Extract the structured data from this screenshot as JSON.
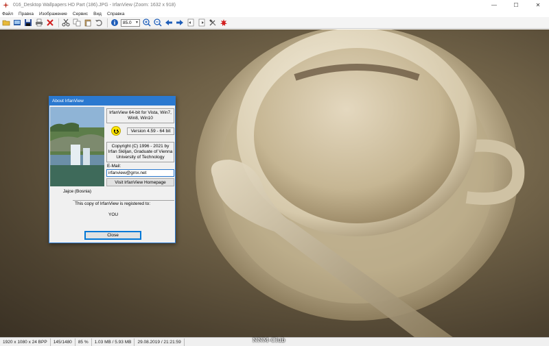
{
  "window": {
    "title": "016_Desktop Wallpapers  HD Part (186).JPG - IrfanView (Zoom: 1632 x 918)",
    "controls": [
      "—",
      "☐",
      "✕"
    ]
  },
  "menu": [
    "Файл",
    "Правка",
    "Изображение",
    "Сервис",
    "Вид",
    "Справка"
  ],
  "toolbar": {
    "zoom_value": "85.0",
    "icons": [
      "open-icon",
      "slideshow-icon",
      "save-icon",
      "print-icon",
      "delete-icon",
      "cut-icon",
      "copy-icon",
      "paste-icon",
      "undo-icon",
      "info-icon",
      "zoom-in-icon",
      "zoom-out-icon",
      "prev-icon",
      "next-icon",
      "prev-page-icon",
      "next-page-icon",
      "settings-icon",
      "exit-icon"
    ]
  },
  "status_bar": {
    "dimensions": "1920 x 1080 x 24 BPP",
    "index": "145/1480",
    "zoom": "85 %",
    "size": "1.03 MB / 5.93 MB",
    "datetime": "29.08.2019 / 21:21:59"
  },
  "watermark": "NNM-Club",
  "about_dialog": {
    "title": "About  IrfanView",
    "product": "IrfanView 64-bit for Vista, Win7, Win8, Win10",
    "version": "Version 4.59 - 64 bit",
    "copyright": "Copyright (C) 1996 - 2021 by Irfan Skiljan, Graduate of Vienna University of Technology",
    "email_label": "E-Mail:",
    "email_value": "irfanview@gmx.net",
    "homepage_button": "Visit IrfanView Homepage",
    "photo_caption": "Jajce (Bosnia)",
    "registered_text": "This copy of IrfanView is registered to:",
    "registered_to": "YOU",
    "close_button": "Close"
  },
  "colors": {
    "dialog_title": "#2b79d0",
    "photo_base": "#6f6147"
  }
}
